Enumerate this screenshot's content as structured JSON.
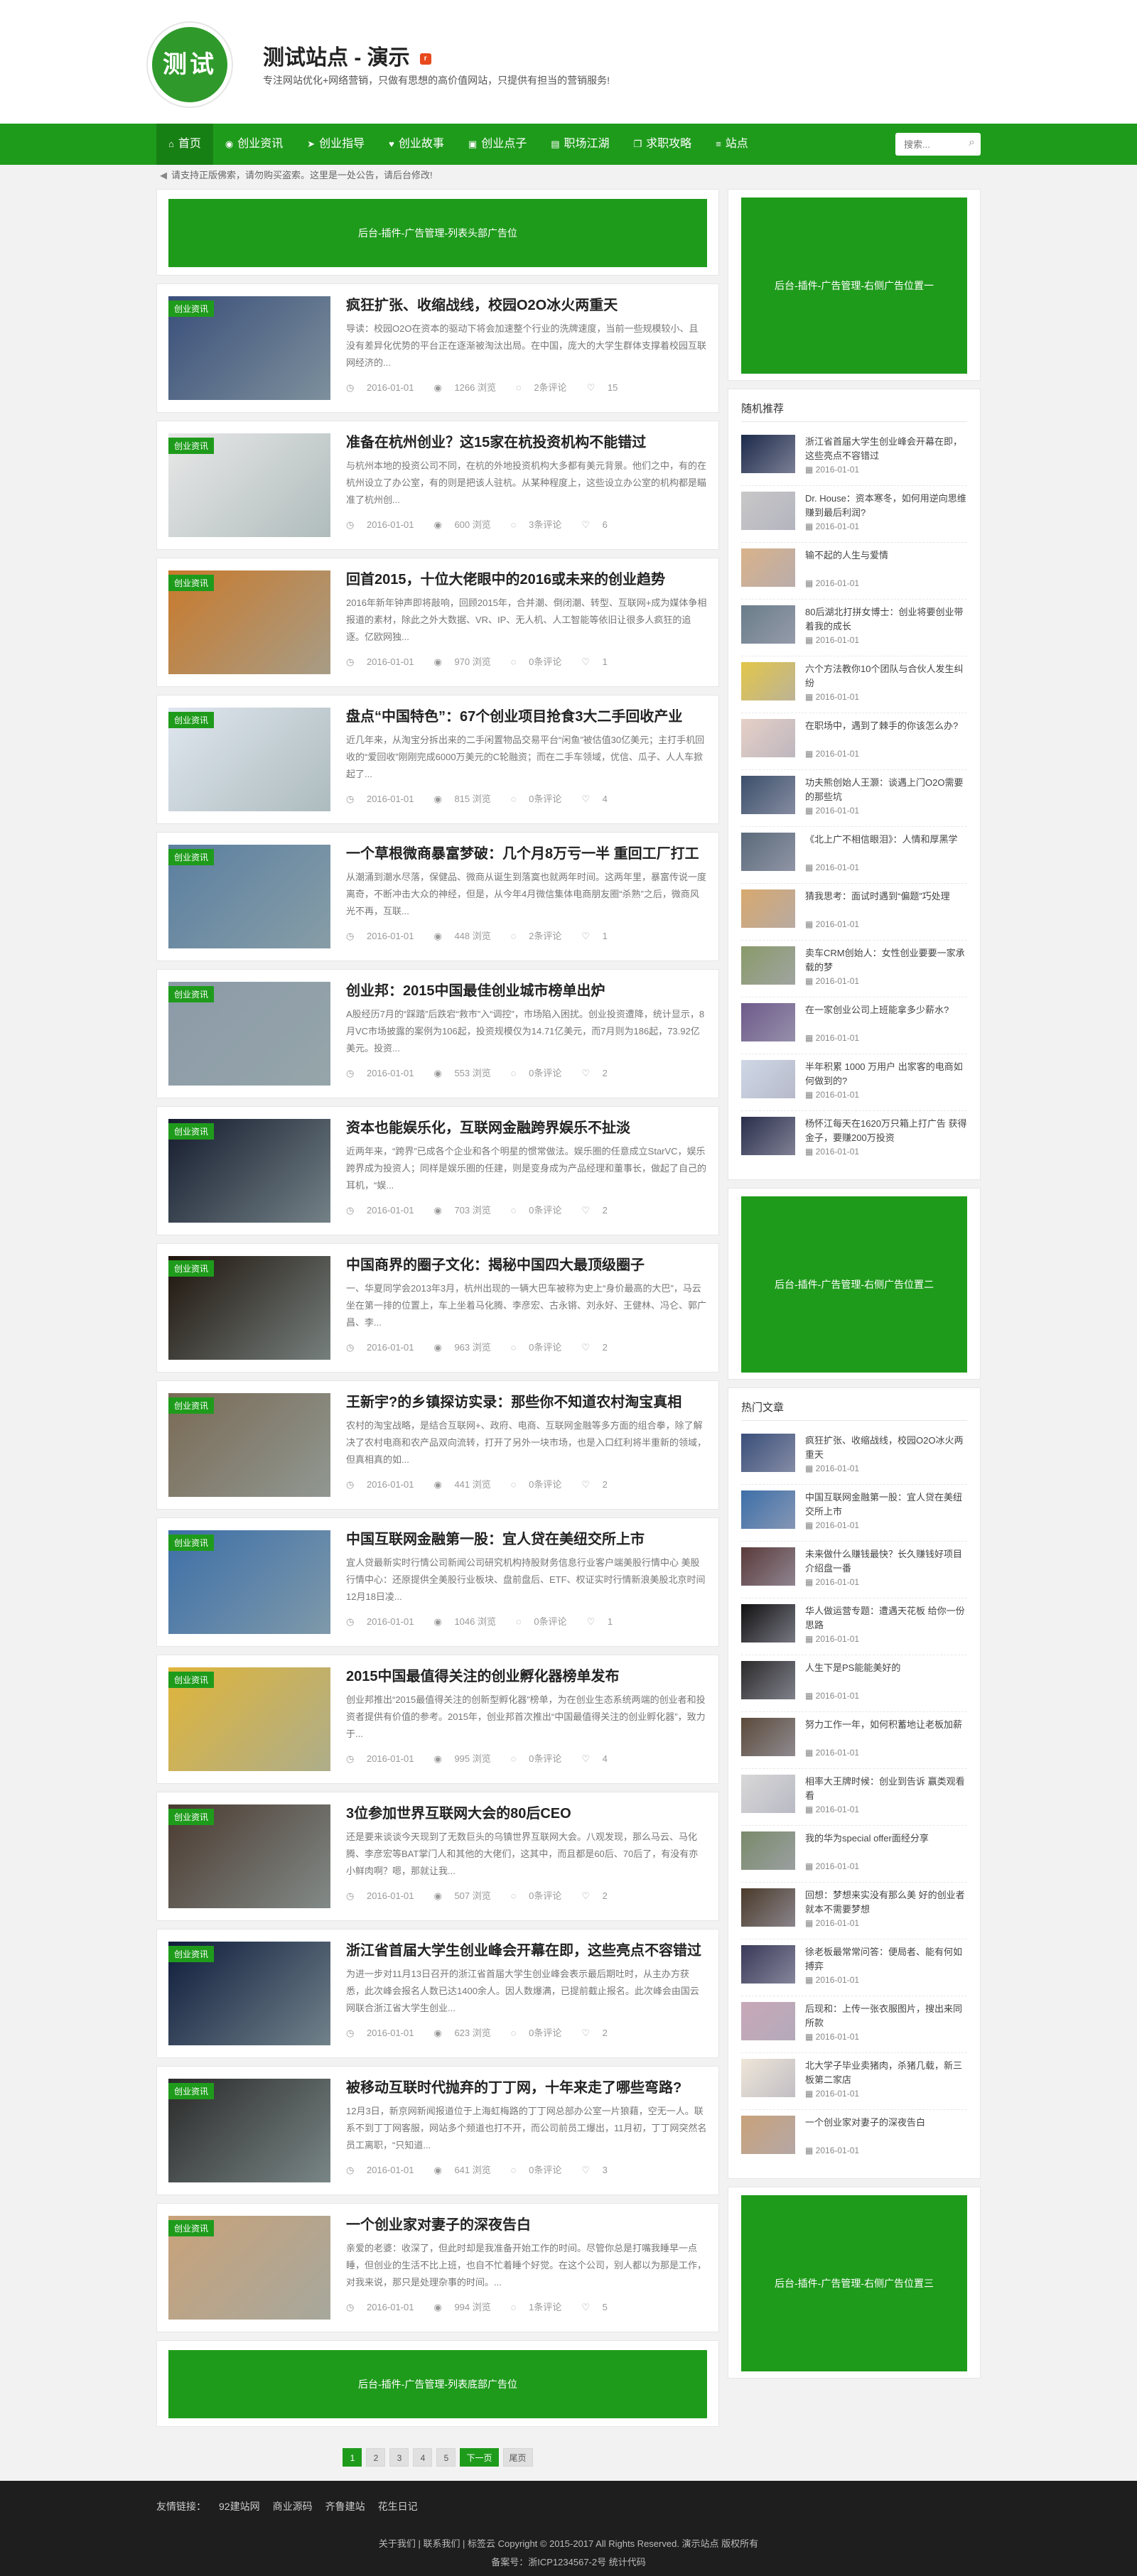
{
  "header": {
    "logo_text": "测试",
    "site_title": "测试站点 - 演示",
    "rss_glyph": "r",
    "tagline": "专注网站优化+网络营销，只做有思想的高价值网站，只提供有担当的营销服务!"
  },
  "nav": {
    "items": [
      {
        "label": "首页",
        "icon": "home-icon",
        "glyph": "⌂"
      },
      {
        "label": "创业资讯",
        "icon": "globe-icon",
        "glyph": "◉"
      },
      {
        "label": "创业指导",
        "icon": "send-icon",
        "glyph": "➤"
      },
      {
        "label": "创业故事",
        "icon": "heart-icon",
        "glyph": "♥"
      },
      {
        "label": "创业点子",
        "icon": "folder-icon",
        "glyph": "▣"
      },
      {
        "label": "职场江湖",
        "icon": "briefcase-icon",
        "glyph": "▤"
      },
      {
        "label": "求职攻略",
        "icon": "copy-icon",
        "glyph": "❐"
      },
      {
        "label": "站点",
        "icon": "list-icon",
        "glyph": "≡"
      }
    ],
    "search_placeholder": "搜索..."
  },
  "notice": "请支持正版佛索，请勿购买盗索。这里是一处公告，请后台修改!",
  "ads": {
    "top": "后台-插件-广告管理-列表头部广告位",
    "bottom": "后台-插件-广告管理-列表底部广告位",
    "side1": "后台-插件-广告管理-右侧广告位置一",
    "side2": "后台-插件-广告管理-右侧广告位置二",
    "side3": "后台-插件-广告管理-右侧广告位置三"
  },
  "posts": [
    {
      "cat": "创业资讯",
      "title": "疯狂扩张、收缩战线，校园O2O冰火两重天",
      "excerpt": "导读：校园O2O在资本的驱动下将会加速整个行业的洗牌速度，当前一些规模较小、且没有差异化优势的平台正在逐渐被淘汰出局。在中国，庞大的大学生群体支撑着校园互联网经济的...",
      "date": "2016-01-01",
      "views": "1266 浏览",
      "comments": "2条评论",
      "likes": "15",
      "color": "#3a4f7a"
    },
    {
      "cat": "创业资讯",
      "title": "准备在杭州创业？这15家在杭投资机构不能错过",
      "excerpt": "与杭州本地的投资公司不同，在杭的外地投资机构大多都有美元背景。他们之中，有的在杭州设立了办公室，有的则是把该人驻杭。从某种程度上，这些设立办公室的机构都是瞄准了杭州创...",
      "date": "2016-01-01",
      "views": "600 浏览",
      "comments": "3条评论",
      "likes": "6",
      "color": "#e8e8e8"
    },
    {
      "cat": "创业资讯",
      "title": "回首2015，十位大佬眼中的2016或未来的创业趋势",
      "excerpt": "2016年新年钟声即将敲响，回顾2015年，合并潮、倒闭潮、转型、互联网+成为媒体争相报道的素材，除此之外大数据、VR、IP、无人机、人工智能等依旧让很多人疯狂的追逐。亿欧网独...",
      "date": "2016-01-01",
      "views": "970 浏览",
      "comments": "0条评论",
      "likes": "1",
      "color": "#c97a2c"
    },
    {
      "cat": "创业资讯",
      "title": "盘点“中国特色”：67个创业项目抢食3大二手回收产业",
      "excerpt": "近几年来，从淘宝分拆出来的二手闲置物品交易平台“闲鱼”被估值30亿美元；主打手机回收的“爱回收”刚刚完成6000万美元的C轮融资；而在二手车领域，优信、瓜子、人人车掀起了...",
      "date": "2016-01-01",
      "views": "815 浏览",
      "comments": "0条评论",
      "likes": "4",
      "color": "#dfe6ef"
    },
    {
      "cat": "创业资讯",
      "title": "一个草根微商暴富梦破：几个月8万亏一半 重回工厂打工",
      "excerpt": "从潮涌到潮水尽落，保健品、微商从诞生到落寞也就两年时间。这两年里，暴富传说一度离奇，不断冲击大众的神经，但是，从今年4月微信集体电商朋友圈“杀熟”之后，微商风光不再，互联...",
      "date": "2016-01-01",
      "views": "448 浏览",
      "comments": "2条评论",
      "likes": "1",
      "color": "#5b7fa0"
    },
    {
      "cat": "创业资讯",
      "title": "创业邦：2015中国最佳创业城市榜单出炉",
      "excerpt": "A股经历7月的“踩踏”后跌宕“救市”入“调控”，市场陷入困扰。创业投资遭降，统计显示，8月VC市场披露的案例为106起，投资规模仅为14.71亿美元，而7月则为186起，73.92亿美元。投资...",
      "date": "2016-01-01",
      "views": "553 浏览",
      "comments": "0条评论",
      "likes": "2",
      "color": "#8c9aa8"
    },
    {
      "cat": "创业资讯",
      "title": "资本也能娱乐化，互联网金融跨界娱乐不扯淡",
      "excerpt": "近两年来，“跨界”已成各个企业和各个明星的惯常做法。娱乐圈的任意成立StarVC，娱乐跨界成为投资人；同样是娱乐圈的任建，则是变身成为产品经理和董事长，做起了自己的耳机，“娱...",
      "date": "2016-01-01",
      "views": "703 浏览",
      "comments": "0条评论",
      "likes": "2",
      "color": "#151c2e"
    },
    {
      "cat": "创业资讯",
      "title": "中国商界的圈子文化：揭秘中国四大最顶级圈子",
      "excerpt": "一、华夏同学会2013年3月，杭州出现的一辆大巴车被称为史上“身价最高的大巴”，马云坐在第一排的位置上，车上坐着马化腾、李彦宏、古永锵、刘永好、王健林、冯仑、郭广昌、李...",
      "date": "2016-01-01",
      "views": "963 浏览",
      "comments": "0条评论",
      "likes": "2",
      "color": "#1e140c"
    },
    {
      "cat": "创业资讯",
      "title": "王新宇?的乡镇探访实录：那些你不知道农村淘宝真相",
      "excerpt": "农村的淘宝战略，是结合互联网+、政府、电商、互联网金融等多方面的组合拳，除了解决了农村电商和农产品双向流转，打开了另外一块市场，也是入口红利将半重新的领域，但真相真的如...",
      "date": "2016-01-01",
      "views": "441 浏览",
      "comments": "0条评论",
      "likes": "2",
      "color": "#7a6a55"
    },
    {
      "cat": "创业资讯",
      "title": "中国互联网金融第一股：宜人贷在美纽交所上市",
      "excerpt": "宜人贷最新实时行情公司新闻公司研究机构持股财务信息行业客户端美股行情中心 美股行情中心：还原提供全美股行业板块、盘前盘后、ETF、权证实时行情新浪美股北京时间12月18日凌...",
      "date": "2016-01-01",
      "views": "1046 浏览",
      "comments": "0条评论",
      "likes": "1",
      "color": "#3d6fa8"
    },
    {
      "cat": "创业资讯",
      "title": "2015中国最值得关注的创业孵化器榜单发布",
      "excerpt": "创业邦推出“2015最值得关注的创新型孵化器”榜单，为在创业生态系统两端的创业者和投资者提供有价值的参考。2015年，创业邦首次推出“中国最值得关注的创业孵化器”，致力于...",
      "date": "2016-01-01",
      "views": "995 浏览",
      "comments": "0条评论",
      "likes": "4",
      "color": "#e0b53a"
    },
    {
      "cat": "创业资讯",
      "title": "3位参加世界互联网大会的80后CEO",
      "excerpt": "还是要来谈谈今天现到了无数巨头的乌镇世界互联网大会。八观发现，那么马云、马化腾、李彦宏等BAT掌门人和其他的大佬们，这其中，而且都是60后、70后了，有没有亦小鲜肉啊？嗯，那就让我...",
      "date": "2016-01-01",
      "views": "507 浏览",
      "comments": "0条评论",
      "likes": "2",
      "color": "#4a3a30"
    },
    {
      "cat": "创业资讯",
      "title": "浙江省首届大学生创业峰会开幕在即，这些亮点不容错过",
      "excerpt": "为进一步对11月13日召开的浙江省首届大学生创业峰会表示最后期吐时，从主办方获悉，此次峰会报名人数已达1400余人。因人数爆满，已提前截止报名。此次峰会由国云网联合浙江省大学生创业...",
      "date": "2016-01-01",
      "views": "623 浏览",
      "comments": "0条评论",
      "likes": "2",
      "color": "#0f1d3c"
    },
    {
      "cat": "创业资讯",
      "title": "被移动互联时代抛弃的丁丁网，十年来走了哪些弯路?",
      "excerpt": "12月3日，新京网新闻报道位于上海虹梅路的丁丁网总部办公室一片狼藉，空无一人。联系不到丁丁网客服，网站多个频道也打不开，而公司前员工爆出，11月初，丁丁网突然名员工离职，“只知道...",
      "date": "2016-01-01",
      "views": "641 浏览",
      "comments": "0条评论",
      "likes": "3",
      "color": "#2a2a2a"
    },
    {
      "cat": "创业资讯",
      "title": "一个创业家对妻子的深夜告白",
      "excerpt": "亲爱的老婆：收深了，但此时却是我准备开始工作的时间。尽管你总是打嘴我睡早一点睡，但创业的生活不比上班，也自不忙着睡个好觉。在这个公司，别人都以为那是工作，对我来说，那只是处理杂事的时间。...",
      "date": "2016-01-01",
      "views": "994 浏览",
      "comments": "1条评论",
      "likes": "5",
      "color": "#c9a27a"
    }
  ],
  "pagination": [
    "1",
    "2",
    "3",
    "4",
    "5",
    "下一页",
    "尾页"
  ],
  "widgets": {
    "random": {
      "title": "随机推荐",
      "items": [
        {
          "title": "浙江省首届大学生创业峰会开幕在即，这些亮点不容错过",
          "date": "2016-01-01",
          "color": "#1c2a4a"
        },
        {
          "title": "Dr. House：资本寒冬，如何用逆向思维赚到最后利润?",
          "date": "2016-01-01",
          "color": "#c8c8c8"
        },
        {
          "title": "输不起的人生与爱情",
          "date": "2016-01-01",
          "color": "#d9b28a"
        },
        {
          "title": "80后湖北打拼女博士：创业将要创业带着我的成长",
          "date": "2016-01-01",
          "color": "#6a7d8a"
        },
        {
          "title": "六个方法教你10个团队与合伙人发生纠纷",
          "date": "2016-01-01",
          "color": "#e2c64a"
        },
        {
          "title": "在职场中，遇到了棘手的你该怎么办?",
          "date": "2016-01-01",
          "color": "#e6d0c6"
        },
        {
          "title": "功夫熊创始人王灏：谈遇上门O2O需要的那些坑",
          "date": "2016-01-01",
          "color": "#3b4f6b"
        },
        {
          "title": "《北上广不相信眼泪》：人情和厚黑学",
          "date": "2016-01-01",
          "color": "#5a6a7a"
        },
        {
          "title": "猜我思考：面试时遇到“偏题”巧处理",
          "date": "2016-01-01",
          "color": "#d7a96e"
        },
        {
          "title": "卖车CRM创始人：女性创业要要一家承载的梦",
          "date": "2016-01-01",
          "color": "#8a9a6a"
        },
        {
          "title": "在一家创业公司上班能拿多少薪水?",
          "date": "2016-01-01",
          "color": "#6e5a8a"
        },
        {
          "title": "半年积累 1000 万用户 出家客的电商如何做到的?",
          "date": "2016-01-01",
          "color": "#cfd8e6"
        },
        {
          "title": "杨怀江每天在1620万只箱上打广告 获得金子，要赚200万投资",
          "date": "2016-01-01",
          "color": "#2a2e4a"
        }
      ]
    },
    "hot": {
      "title": "热门文章",
      "items": [
        {
          "title": "疯狂扩张、收缩战线，校园O2O冰火两重天",
          "date": "2016-01-01",
          "color": "#3a4f7a"
        },
        {
          "title": "中国互联网金融第一股：宜人贷在美纽交所上市",
          "date": "2016-01-01",
          "color": "#3d6fa8"
        },
        {
          "title": "未来做什么赚钱最快？长久赚钱好项目介绍盘一番",
          "date": "2016-01-01",
          "color": "#5a3a3a"
        },
        {
          "title": "华人做运营专题：遭遇天花板 给你一份思路",
          "date": "2016-01-01",
          "color": "#111"
        },
        {
          "title": "人生下是PS能能美好的",
          "date": "2016-01-01",
          "color": "#2b2b2b"
        },
        {
          "title": "努力工作一年，如何积蓄地让老板加薪",
          "date": "2016-01-01",
          "color": "#5a4a3a"
        },
        {
          "title": "相率大王牌时候：创业到告诉 赢类观看看",
          "date": "2016-01-01",
          "color": "#d8d8d8"
        },
        {
          "title": "我的华为special offer面经分享",
          "date": "2016-01-01",
          "color": "#7a8a6a"
        },
        {
          "title": "回想：梦想来实没有那么美 好的创业者就本不需要梦想",
          "date": "2016-01-01",
          "color": "#4a3a2a"
        },
        {
          "title": "徐老板最常常问答：便局者、能有何如搏弈",
          "date": "2016-01-01",
          "color": "#3a3a5a"
        },
        {
          "title": "后现和：上传一张衣服图片，搜出来同所款",
          "date": "2016-01-01",
          "color": "#c8a8b8"
        },
        {
          "title": "北大学子毕业卖猪肉，杀猪几载，新三板第二家店",
          "date": "2016-01-01",
          "color": "#efe6d8"
        },
        {
          "title": "一个创业家对妻子的深夜告白",
          "date": "2016-01-01",
          "color": "#c9a27a"
        }
      ]
    }
  },
  "footer": {
    "friend_label": "友情链接：",
    "friend_links": [
      "92建站网",
      "商业源码",
      "齐鲁建站",
      "花生日记"
    ],
    "copyright": "关于我们 | 联系我们 | 标签云 Copyright © 2015-2017 All Rights Reserved. 演示站点 版权所有",
    "icp": "备案号：浙ICP1234567-2号 统计代码"
  }
}
